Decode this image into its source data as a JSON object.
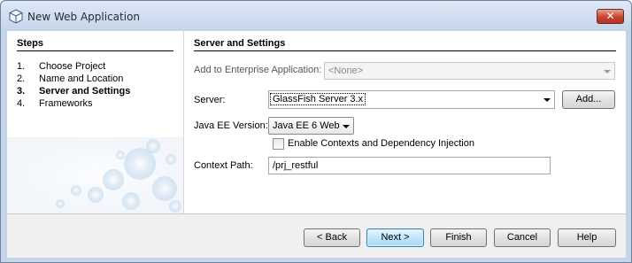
{
  "window": {
    "title": "New Web Application",
    "close_glyph": "✕",
    "icon": "netbeans-cube-icon"
  },
  "steps": {
    "title": "Steps",
    "items": [
      {
        "num": "1.",
        "label": "Choose Project"
      },
      {
        "num": "2.",
        "label": "Name and Location"
      },
      {
        "num": "3.",
        "label": "Server and Settings",
        "current": true
      },
      {
        "num": "4.",
        "label": "Frameworks"
      }
    ]
  },
  "main": {
    "title": "Server and Settings",
    "enterprise": {
      "label": "Add to Enterprise Application:",
      "value": "<None>"
    },
    "server": {
      "label": "Server:",
      "value": "GlassFish Server 3.x",
      "add_label": "Add..."
    },
    "javaee": {
      "label": "Java EE Version:",
      "value": "Java EE 6 Web"
    },
    "cdi": {
      "label": "Enable Contexts and Dependency Injection",
      "checked": false
    },
    "context": {
      "label": "Context Path:",
      "value": "/prj_restful"
    }
  },
  "footer": {
    "back": "< Back",
    "next": "Next >",
    "finish": "Finish",
    "cancel": "Cancel",
    "help": "Help"
  },
  "colors": {
    "titlebar": "#c4d5ea",
    "close": "#c7432e",
    "default_button": "#bee6fd"
  }
}
